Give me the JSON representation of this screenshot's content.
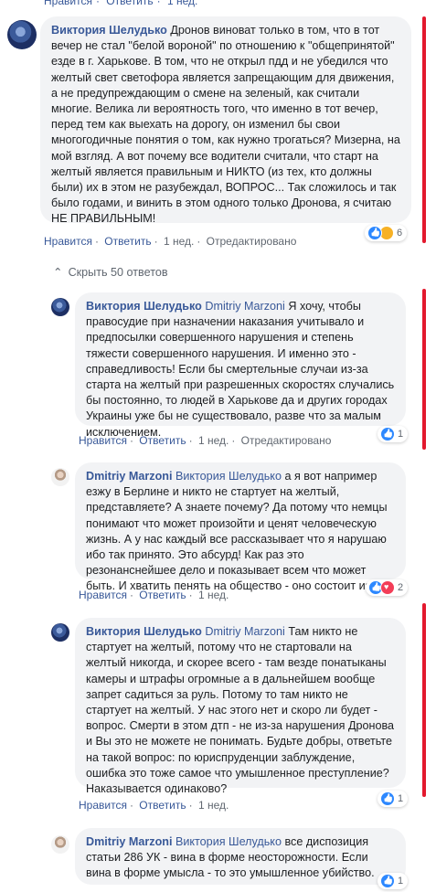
{
  "top_actions": {
    "like": "Нравится",
    "reply": "Ответить",
    "time": "1 нед."
  },
  "comments": [
    {
      "author": "Виктория Шелудько",
      "text": "Дронов виноват только в том, что в тот вечер не стал \"белой вороной\" по отношению к \"общепринятой\" езде в г. Харькове. В том, что не открыл пдд и не убедился что желтый свет светофора является запрещающим для движения, а не предупреждающим о смене на зеленый, как считали многие. Велика ли вероятность того, что именно в тот вечер, перед тем как выехать на дорогу, он изменил бы свои многогодичные понятия о том, как нужно трогаться? Мизерна, на мой взгляд. А вот почему все водители считали, что старт на желтый является правильным и НИКТО (из тех, кто должны были) их в этом не разубеждал, ВОПРОС... Так сложилось и так было годами, и винить в этом одного только Дронова, я считаю НЕ ПРАВИЛЬНЫМ!",
      "like": "Нравится",
      "reply": "Ответить",
      "time": "1 нед.",
      "edited": "Отредактировано",
      "reactions_count": "6"
    }
  ],
  "hide_replies": "Скрыть 50 ответов",
  "replies": [
    {
      "author": "Виктория Шелудько",
      "mention": "Dmitriy Marzoni",
      "text": "Я хочу, чтобы правосудие при назначении наказания учитывало и предпосылки совершенного нарушения и степень тяжести совершенного нарушения. И именно это - справедливость! Если бы смертельные случаи из-за старта на желтый при разрешенных скоростях случались бы постоянно, то людей в Харькове да и других городах Украины уже бы не существовало, разве что за малым исключением.",
      "like": "Нравится",
      "reply": "Ответить",
      "time": "1 нед.",
      "edited": "Отредактировано",
      "reactions_count": "1"
    },
    {
      "author": "Dmitriy Marzoni",
      "mention": "Виктория Шелудько",
      "text": "а я вот например езжу в Берлине и никто не стартует на желтый, представляете? А знаете почему? Да потому что немцы понимают что может произойти и ценят человеческую жизнь. А у нас каждый все рассказывает что я нарушаю ибо так принято. Это абсурд! Как раз это резонанснейшее дело и показывает всем что может быть. И хватить пенять на общество - оно состоит из нас",
      "like": "Нравится",
      "reply": "Ответить",
      "time": "1 нед.",
      "reactions_count": "2"
    },
    {
      "author": "Виктория Шелудько",
      "mention": "Dmitriy Marzoni",
      "text": "Там никто не стартует на желтый, потому что не стартовали на желтый никогда, и скорее всего - там везде понатыканы камеры и штрафы огромные а в дальнейшем вообще запрет садиться за руль. Потому то там никто не стартует на желтый. У нас этого нет и скоро ли будет - вопрос. Смерти в этом дтп - не из-за нарушения Дронова и Вы это не можете не понимать. Будьте добры, ответьте на такой вопрос: по юриспруденции заблуждение, ошибка это тоже самое что умышленное преступление? Наказывается одинаково?",
      "like": "Нравится",
      "reply": "Ответить",
      "time": "1 нед.",
      "reactions_count": "1"
    },
    {
      "author": "Dmitriy Marzoni",
      "mention": "Виктория Шелудько",
      "text": "все диспозиция статьи 286 УК - вина в форме неосторожности. Если вина в форме умысла - то это умышленное убийство.",
      "reactions_count": "1"
    }
  ],
  "colors": {
    "link": "#385898",
    "bubble": "#f2f3f5",
    "marker": "#e3192e"
  }
}
